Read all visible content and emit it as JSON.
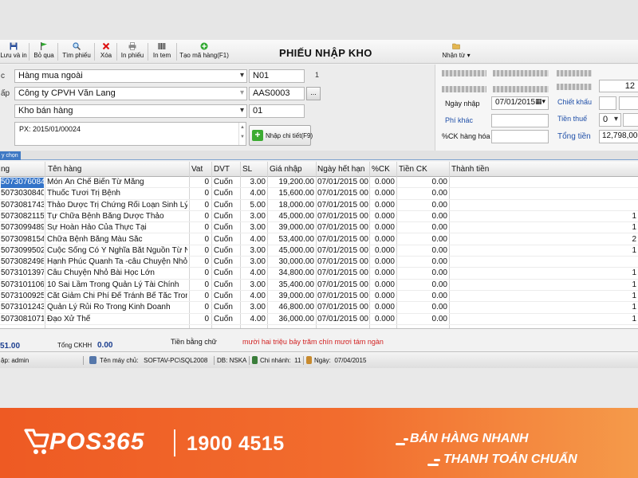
{
  "toolbar": {
    "buttons": [
      {
        "label": "Lưu và in",
        "icon": "floppy-disk-icon"
      },
      {
        "label": "Bỏ qua",
        "icon": "green-flag-icon"
      },
      {
        "label": "Tìm phiếu",
        "icon": "magnifier-icon"
      },
      {
        "label": "Xóa",
        "icon": "red-x-icon"
      },
      {
        "label": "In phiếu",
        "icon": "printer-icon"
      },
      {
        "label": "In tem",
        "icon": "barcode-icon"
      },
      {
        "label": "Tạo mã hàng(F1)",
        "icon": "green-plus-icon"
      }
    ],
    "title": "PHIẾU NHẬP KHO",
    "right_button": "Nhận từ"
  },
  "header": {
    "label_fragments": [
      "c",
      "ấp"
    ],
    "import_type": "Hàng mua ngoài",
    "import_type_code": "N01",
    "import_type_num": "1",
    "supplier": "Công ty CPVH Văn Lang",
    "supplier_code": "AAS0003",
    "warehouse": "Kho bán hàng",
    "warehouse_code": "01",
    "notes": "PX: 2015/01/00024",
    "detail_button": "Nhập chi tiết(F9)"
  },
  "right_panel": {
    "ngay_nhap_label": "Ngày nhập",
    "ngay_nhap": "07/01/2015",
    "phi_khac_label": "Phí khác",
    "ck_hang_hoa_label": "%CK hàng hóa",
    "chiet_khau_label": "Chiết khấu",
    "tien_thue_label": "Tiền thuế",
    "tien_thue_value": "0",
    "tong_tien_label": "Tổng tiền",
    "tong_tien": "12,798,000",
    "top_right_value": "12"
  },
  "tab": {
    "label": "y chọn"
  },
  "grid": {
    "headers": [
      "ng",
      "Tên hàng",
      "Vat",
      "DVT",
      "SL",
      "Giá nhập",
      "Ngày hết hạn",
      "%CK",
      "Tiền CK",
      "Thành tiền"
    ],
    "rows": [
      {
        "code": "5073076084",
        "name": "Món Ăn Chế Biến Từ Măng",
        "vat": "0",
        "dvt": "Cuốn",
        "sl": "3.00",
        "gia": "19,200.00",
        "hsd": "07/01/2015 00:",
        "ck": "0.000",
        "tienck": "0.00",
        "tail": ""
      },
      {
        "code": "5073030840",
        "name": "Thuốc Tươi Trị Bệnh",
        "vat": "0",
        "dvt": "Cuốn",
        "sl": "4.00",
        "gia": "15,600.00",
        "hsd": "07/01/2015 00:",
        "ck": "0.000",
        "tienck": "0.00",
        "tail": ""
      },
      {
        "code": "5073081743",
        "name": "Thảo Dược Trị Chứng Rối Loạn Sinh Lý",
        "vat": "0",
        "dvt": "Cuốn",
        "sl": "5.00",
        "gia": "18,000.00",
        "hsd": "07/01/2015 00:",
        "ck": "0.000",
        "tienck": "0.00",
        "tail": ""
      },
      {
        "code": "5073082115",
        "name": "Tự Chữa Bệnh Bằng Dược Thảo",
        "vat": "0",
        "dvt": "Cuốn",
        "sl": "3.00",
        "gia": "45,000.00",
        "hsd": "07/01/2015 00:",
        "ck": "0.000",
        "tienck": "0.00",
        "tail": "1"
      },
      {
        "code": "5073099489",
        "name": "Sự Hoàn Hảo Của Thực Tại",
        "vat": "0",
        "dvt": "Cuốn",
        "sl": "3.00",
        "gia": "39,000.00",
        "hsd": "07/01/2015 00:",
        "ck": "0.000",
        "tienck": "0.00",
        "tail": "1"
      },
      {
        "code": "5073098154",
        "name": "Chữa Bệnh Bằng Màu Sắc",
        "vat": "0",
        "dvt": "Cuốn",
        "sl": "4.00",
        "gia": "53,400.00",
        "hsd": "07/01/2015 00:",
        "ck": "0.000",
        "tienck": "0.00",
        "tail": "2"
      },
      {
        "code": "5073099502",
        "name": "Cuộc Sống Có Ý Nghĩa Bắt Nguồn Từ N",
        "vat": "0",
        "dvt": "Cuốn",
        "sl": "3.00",
        "gia": "45,000.00",
        "hsd": "07/01/2015 00:",
        "ck": "0.000",
        "tienck": "0.00",
        "tail": "1"
      },
      {
        "code": "5073082498",
        "name": "Hạnh Phúc Quanh Ta -câu Chuyện Nhỏ",
        "vat": "0",
        "dvt": "Cuốn",
        "sl": "3.00",
        "gia": "30,000.00",
        "hsd": "07/01/2015 00:",
        "ck": "0.000",
        "tienck": "0.00",
        "tail": ""
      },
      {
        "code": "5073101397",
        "name": "Câu Chuyện Nhỏ Bài Học Lớn",
        "vat": "0",
        "dvt": "Cuốn",
        "sl": "4.00",
        "gia": "34,800.00",
        "hsd": "07/01/2015 00:",
        "ck": "0.000",
        "tienck": "0.00",
        "tail": "1"
      },
      {
        "code": "5073101106",
        "name": "10 Sai Lầm Trong Quản Lý Tài Chính",
        "vat": "0",
        "dvt": "Cuốn",
        "sl": "3.00",
        "gia": "35,400.00",
        "hsd": "07/01/2015 00:",
        "ck": "0.000",
        "tienck": "0.00",
        "tail": "1"
      },
      {
        "code": "5073100925",
        "name": "Cắt Giảm Chi Phí Để Tránh Bế Tắc Tron",
        "vat": "0",
        "dvt": "Cuốn",
        "sl": "4.00",
        "gia": "39,000.00",
        "hsd": "07/01/2015 00:",
        "ck": "0.000",
        "tienck": "0.00",
        "tail": "1"
      },
      {
        "code": "5073101243",
        "name": "Quản Lý Rủi Ro Trong Kinh Doanh",
        "vat": "0",
        "dvt": "Cuốn",
        "sl": "3.00",
        "gia": "46,800.00",
        "hsd": "07/01/2015 00:",
        "ck": "0.000",
        "tienck": "0.00",
        "tail": "1"
      },
      {
        "code": "5073081071",
        "name": "Đạo Xử Thế",
        "vat": "0",
        "dvt": "Cuốn",
        "sl": "4.00",
        "gia": "36,000.00",
        "hsd": "07/01/2015 00:",
        "ck": "0.000",
        "tienck": "0.00",
        "tail": "1"
      }
    ]
  },
  "totals": {
    "total_fragment": "51.00",
    "ckhh_label": "Tổng CKHH",
    "ckhh_value": "0.00",
    "words_label": "Tiền bằng chữ",
    "words_value": "mười hai triệu  bảy trăm  chín mươi tám ngàn"
  },
  "status_bar": {
    "user_label": "ập:",
    "user": "admin",
    "server_label": "Tên máy chủ:",
    "server": "SOFTAV-PC\\SQL2008",
    "db_label": "DB:",
    "db": "NSKA",
    "branch_label": "Chi nhánh:",
    "branch": "11",
    "date_label": "Ngày:",
    "date": "07/04/2015"
  },
  "banner": {
    "brand": "POS365",
    "hotline": "1900 4515",
    "slogan_1": "BÁN HÀNG NHANH",
    "slogan_2": "THANH TOÁN CHUẨN",
    "colors": {
      "orange": "#ee5a23",
      "white": "#ffffff"
    }
  }
}
